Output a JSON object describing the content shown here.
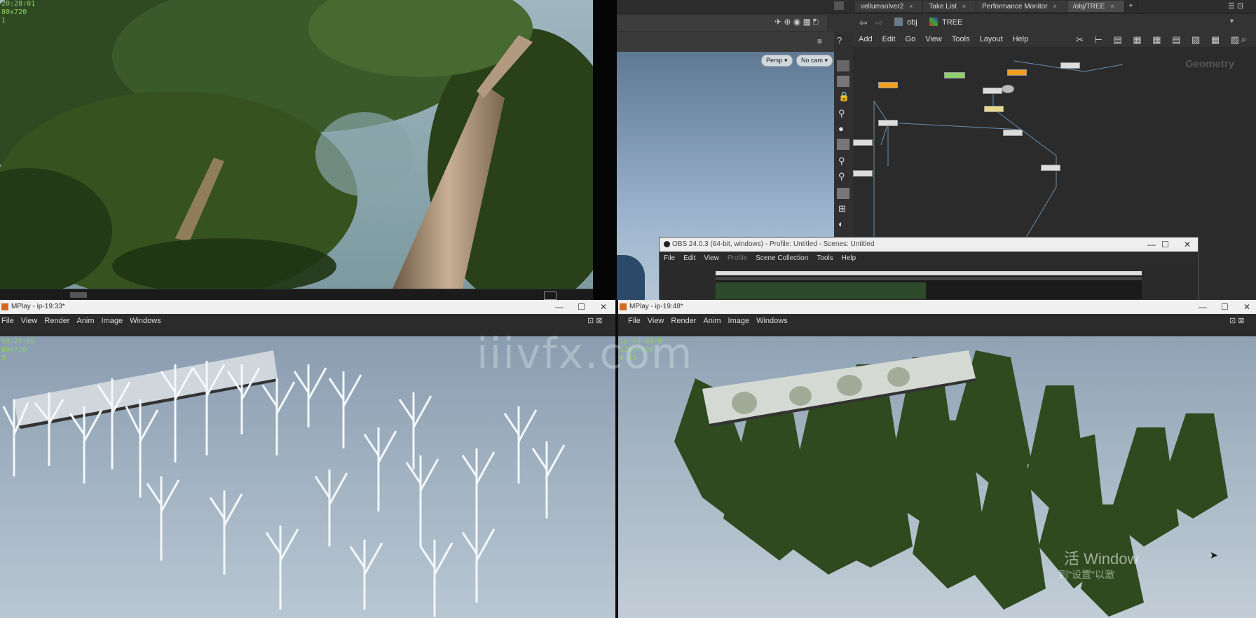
{
  "forest_hud": {
    "line1": "20:28:01",
    "line2": "80x720",
    "line3": "1"
  },
  "houdini": {
    "tabs": [
      {
        "label": "vellumsolver2"
      },
      {
        "label": "Take List"
      },
      {
        "label": "Performance Monitor"
      },
      {
        "label": "/obj/TREE"
      }
    ],
    "path_obj": "obj",
    "path_tree": "TREE",
    "network_menu": [
      "Add",
      "Edit",
      "Go",
      "View",
      "Tools",
      "Layout",
      "Help"
    ],
    "viewport_buttons": {
      "persp": "Persp ▾",
      "cam": "No cam ▾"
    },
    "context_label": "Geometry"
  },
  "obs": {
    "title": "OBS 24.0.3 (64-bit, windows) - Profile: Untitled - Scenes: Untitled",
    "menu": [
      "File",
      "Edit",
      "View",
      "Profile",
      "Scene Collection",
      "Tools",
      "Help"
    ]
  },
  "mplay_left": {
    "title": "MPlay - ip-19:33*",
    "menu": [
      "File",
      "View",
      "Render",
      "Anim",
      "Image",
      "Windows"
    ],
    "hud": {
      "line1": "19:22:05",
      "line2": "80x720",
      "line3": "5"
    }
  },
  "mplay_right": {
    "title": "MPlay - ip-19:48*",
    "menu": [
      "File",
      "View",
      "Render",
      "Anim",
      "Image",
      "Windows"
    ],
    "hud": {
      "line1": "ip-19:48:0",
      "line2": "1280x720",
      "line3": "# 15"
    }
  },
  "watermark": "iiivfx.com",
  "activate_windows": {
    "line1": "活 Window",
    "line2": "到\"设置\"以激"
  },
  "colors": {
    "accent_orange": "#f0a020",
    "node_green": "#8fd06a",
    "hud_green": "#8fd06a"
  }
}
